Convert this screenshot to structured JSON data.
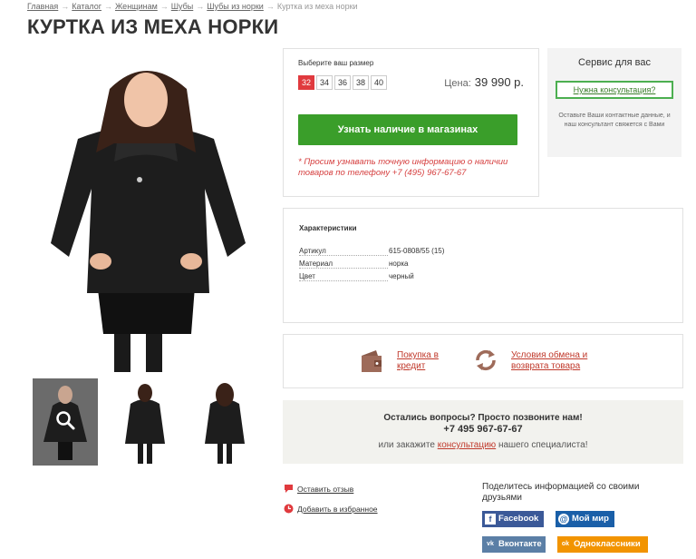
{
  "breadcrumb": {
    "items": [
      "Главная",
      "Каталог",
      "Женщинам",
      "Шубы",
      "Шубы из норки"
    ],
    "current": "Куртка из меха норки",
    "separator": "→"
  },
  "title": "КУРТКА ИЗ МЕХА НОРКИ",
  "gallery": {
    "thumb_count": 3,
    "zoom_icon": "magnifier-icon"
  },
  "size_box": {
    "label": "Выберите ваш размер",
    "sizes": [
      "32",
      "34",
      "36",
      "38",
      "40"
    ],
    "selected": "32",
    "price_label": "Цена:",
    "price": "39 990 р.",
    "availability_button": "Узнать наличие в магазинах",
    "note_star": "*",
    "note": "Просим узнавать точную информацию о наличии товаров по телефону +7 (495) 967-67-67"
  },
  "service": {
    "title": "Сервис для вас",
    "button": "Нужна консультация?",
    "text": "Оставьте Ваши контактные данные, и наш консультант свяжется с Вами"
  },
  "characteristics": {
    "title": "Характеристики",
    "rows": [
      {
        "key": "Артикул",
        "value": "615-0808/55 (15)"
      },
      {
        "key": "Материал",
        "value": "норка"
      },
      {
        "key": "Цвет",
        "value": "черный"
      }
    ]
  },
  "links": {
    "credit": "Покупка в кредит",
    "exchange": "Условия обмена и возврата товара"
  },
  "call": {
    "line1": "Остались вопросы? Просто позвоните нам!",
    "phone": "+7 495 967-67-67",
    "line3_prefix": "или закажите",
    "line3_link": "консультацию",
    "line3_suffix": "нашего специалиста!"
  },
  "actions": {
    "review": "Оставить отзыв",
    "favorite": "Добавить в избранное"
  },
  "share": {
    "title": "Поделитесь информацией со своими друзьями",
    "buttons": [
      {
        "label": "Facebook",
        "icon": "f",
        "color": "#3b5998"
      },
      {
        "label": "Мой мир",
        "icon": "@",
        "color": "#1a5fa8"
      },
      {
        "label": "Вконтакте",
        "icon": "vk",
        "color": "#5b7fa6"
      },
      {
        "label": "Одноклассники",
        "icon": "ok",
        "color": "#f29400"
      }
    ]
  },
  "colors": {
    "accent_red": "#e03a3e",
    "green_button": "#3a9e2a",
    "link_red": "#c0392b"
  }
}
